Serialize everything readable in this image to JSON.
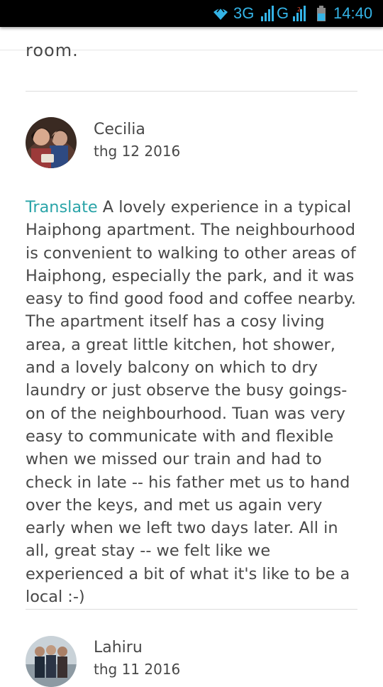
{
  "status_bar": {
    "network_3g": "3G",
    "network_g": "G",
    "time": "14:40",
    "accent_color": "#34b4e7"
  },
  "previous_review": {
    "text_fragment": "room."
  },
  "reviews": [
    {
      "name": "Cecilia",
      "date": "thg 12 2016",
      "translate_label": "Translate",
      "body": "A lovely experience in a typical Haiphong apartment. The neighbourhood is convenient to walking to other areas of Haiphong, especially the park, and it was easy to find good food and coffee nearby. The apartment itself has a cosy living area, a great little kitchen, hot shower, and a lovely balcony on which to dry laundry or just observe the busy goings-on of the neighbourhood. Tuan was very easy to communicate with and flexible when we missed our train and had to check in late -- his father met us to hand over the keys, and met us again very early when we left two days later. All in all, great stay -- we felt like we experienced a bit of what it's like to be a local :-)"
    },
    {
      "name": "Lahiru",
      "date": "thg 11 2016"
    }
  ],
  "colors": {
    "text": "#484848",
    "translate_link": "#2aa4a8",
    "divider": "#dcdcdc"
  }
}
